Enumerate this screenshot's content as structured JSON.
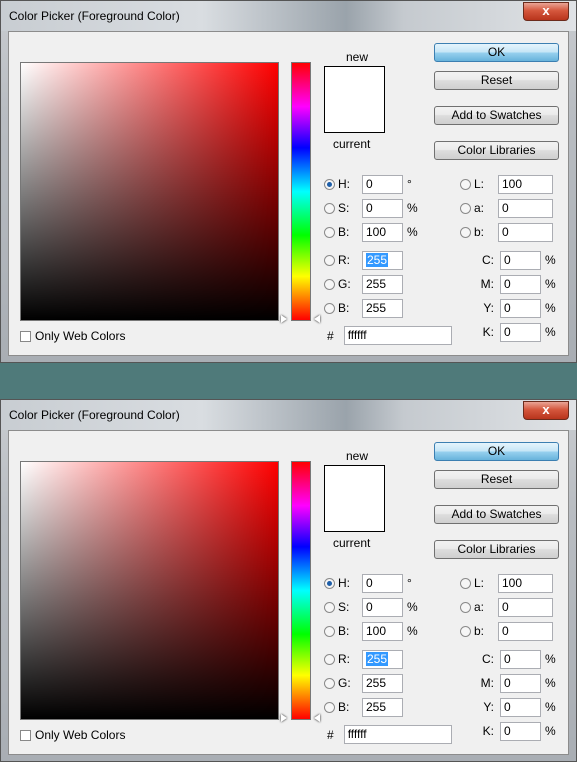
{
  "dialogs": [
    {
      "title": "Color Picker (Foreground Color)",
      "close_glyph": "x",
      "only_web_colors_label": "Only Web Colors",
      "new_label": "new",
      "current_label": "current",
      "buttons": {
        "ok": "OK",
        "reset": "Reset",
        "add_to_swatches": "Add to Swatches",
        "color_libraries": "Color Libraries"
      },
      "hsb": {
        "h_label": "H:",
        "h_value": "0",
        "h_unit": "°",
        "s_label": "S:",
        "s_value": "0",
        "s_unit": "%",
        "b_label": "B:",
        "b_value": "100",
        "b_unit": "%"
      },
      "rgb": {
        "r_label": "R:",
        "r_value": "255",
        "g_label": "G:",
        "g_value": "255",
        "b_label": "B:",
        "b_value": "255"
      },
      "lab": {
        "l_label": "L:",
        "l_value": "100",
        "a_label": "a:",
        "a_value": "0",
        "b_label": "b:",
        "b_value": "0"
      },
      "cmyk": {
        "c_label": "C:",
        "c_value": "0",
        "m_label": "M:",
        "m_value": "0",
        "y_label": "Y:",
        "y_value": "0",
        "k_label": "K:",
        "k_value": "0",
        "unit": "%"
      },
      "hex": {
        "label": "#",
        "value": "ffffff"
      },
      "selected_radio": "H",
      "new_color": "#ffffff",
      "hue_color": "#ff0000"
    },
    {
      "title": "Color Picker (Foreground Color)",
      "close_glyph": "x",
      "only_web_colors_label": "Only Web Colors",
      "new_label": "new",
      "current_label": "current",
      "buttons": {
        "ok": "OK",
        "reset": "Reset",
        "add_to_swatches": "Add to Swatches",
        "color_libraries": "Color Libraries"
      },
      "hsb": {
        "h_label": "H:",
        "h_value": "0",
        "h_unit": "°",
        "s_label": "S:",
        "s_value": "0",
        "s_unit": "%",
        "b_label": "B:",
        "b_value": "100",
        "b_unit": "%"
      },
      "rgb": {
        "r_label": "R:",
        "r_value": "255",
        "g_label": "G:",
        "g_value": "255",
        "b_label": "B:",
        "b_value": "255"
      },
      "lab": {
        "l_label": "L:",
        "l_value": "100",
        "a_label": "a:",
        "a_value": "0",
        "b_label": "b:",
        "b_value": "0"
      },
      "cmyk": {
        "c_label": "C:",
        "c_value": "0",
        "m_label": "M:",
        "m_value": "0",
        "y_label": "Y:",
        "y_value": "0",
        "k_label": "K:",
        "k_value": "0",
        "unit": "%"
      },
      "hex": {
        "label": "#",
        "value": "ffffff"
      },
      "selected_radio": "H",
      "new_color": "#ffffff",
      "hue_color": "#ff0000"
    }
  ]
}
